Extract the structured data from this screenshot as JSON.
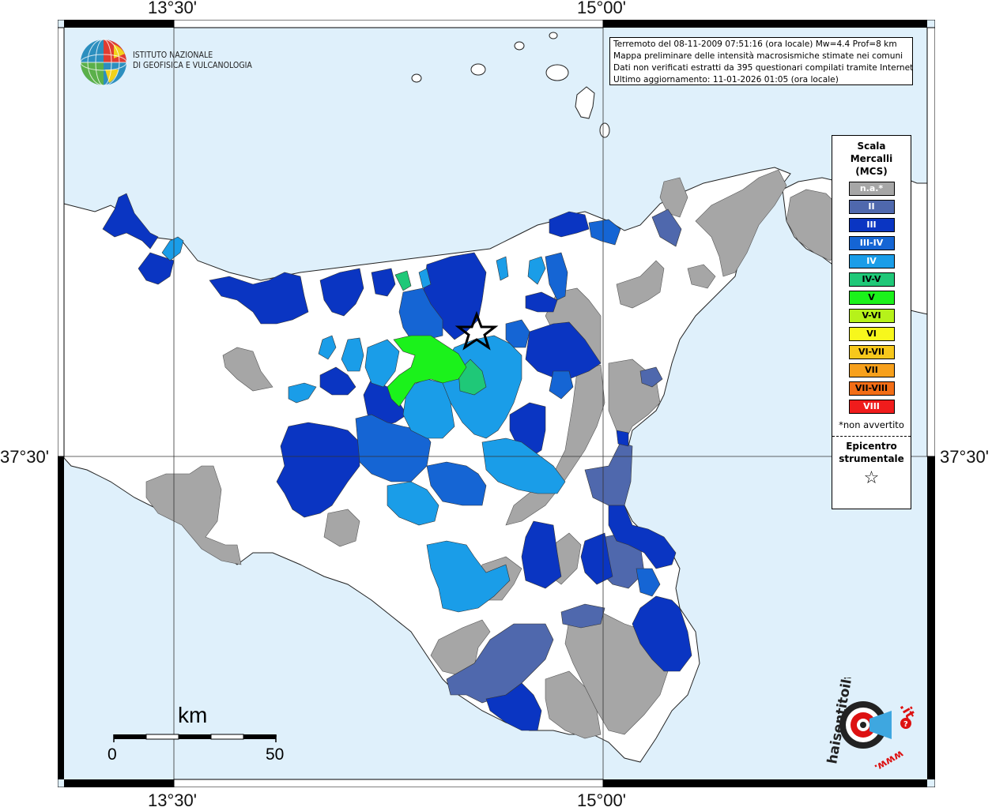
{
  "coords": {
    "top_left": "13°30'",
    "top_right": "15°00'",
    "bottom_left": "13°30'",
    "bottom_right": "15°00'",
    "left_mid": "37°30'",
    "right_mid": "37°30'"
  },
  "ingv_logo": {
    "line1": "ISTITUTO NAZIONALE",
    "line2": "DI GEOFISICA E VULCANOLOGIA"
  },
  "info": {
    "line1": "Terremoto del 08-11-2009 07:51:16 (ora locale) Mw=4.4 Prof=8 km",
    "line2": "Mappa preliminare delle intensità macrosismiche stimate nei comuni",
    "line3": "Dati non verificati estratti da 395 questionari compilati tramite Internet.",
    "line4": "Ultimo aggiornamento: 11-01-2026 01:05 (ora locale)"
  },
  "legend": {
    "title1": "Scala",
    "title2": "Mercalli",
    "title3": "(MCS)",
    "items": [
      {
        "label": "n.a.*",
        "color": "#a6a6a6",
        "text_color": "#ffffff"
      },
      {
        "label": "II",
        "color": "#4f68ad",
        "text_color": "#ffffff"
      },
      {
        "label": "III",
        "color": "#0a35c2",
        "text_color": "#ffffff"
      },
      {
        "label": "III-IV",
        "color": "#1565d4",
        "text_color": "#ffffff"
      },
      {
        "label": "IV",
        "color": "#1a9de8",
        "text_color": "#ffffff"
      },
      {
        "label": "IV-V",
        "color": "#1fc878",
        "text_color": "#000000"
      },
      {
        "label": "V",
        "color": "#1bf21b",
        "text_color": "#000000"
      },
      {
        "label": "V-VI",
        "color": "#b6f21a",
        "text_color": "#000000"
      },
      {
        "label": "VI",
        "color": "#f7f71c",
        "text_color": "#000000"
      },
      {
        "label": "VI-VII",
        "color": "#f7c81c",
        "text_color": "#000000"
      },
      {
        "label": "VII",
        "color": "#f7a01c",
        "text_color": "#000000"
      },
      {
        "label": "VII-VIII",
        "color": "#f26d16",
        "text_color": "#000000"
      },
      {
        "label": "VIII",
        "color": "#f01c1c",
        "text_color": "#ffffff"
      }
    ],
    "na_note": "*non avvertito",
    "epicenter1": "Epicentro",
    "epicenter2": "strumentale",
    "epicenter_icon": "star-outline-icon"
  },
  "scale_bar": {
    "unit": "km",
    "min_label": "0",
    "max_label": "50"
  },
  "hsit_logo": {
    "text_main": "haisentitoilterremoto",
    "text_it": ".it",
    "text_www": "www.",
    "icon": "target-speaker-icon"
  },
  "colors": {
    "sea": "#dff0fb",
    "land": "#ffffff",
    "coast": "#222222",
    "grid": "#333333"
  }
}
